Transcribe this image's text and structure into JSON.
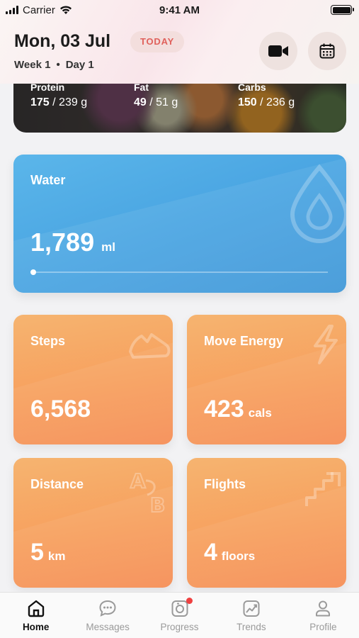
{
  "status_bar": {
    "carrier": "Carrier",
    "time": "9:41 AM"
  },
  "header": {
    "date": "Mon, 03 Jul",
    "badge": "TODAY",
    "week": "Week 1",
    "separator": "•",
    "day": "Day 1",
    "video_icon": "video-camera-icon",
    "calendar_icon": "calendar-icon"
  },
  "macros": [
    {
      "label": "Protein",
      "value": "175",
      "goal": "/ 239 g"
    },
    {
      "label": "Fat",
      "value": "49",
      "goal": "/ 51 g"
    },
    {
      "label": "Carbs",
      "value": "150",
      "goal": "/ 236 g"
    }
  ],
  "water": {
    "title": "Water",
    "value": "1,789",
    "unit": "ml",
    "icon": "water-drop-icon"
  },
  "metrics": {
    "steps": {
      "title": "Steps",
      "value": "6,568",
      "unit": "",
      "icon": "shoe-icon"
    },
    "move_energy": {
      "title": "Move Energy",
      "value": "423",
      "unit": "cals",
      "icon": "lightning-icon"
    },
    "distance": {
      "title": "Distance",
      "value": "5",
      "unit": "km",
      "icon": "a-to-b-icon"
    },
    "flights": {
      "title": "Flights",
      "value": "4",
      "unit": "floors",
      "icon": "stairs-icon"
    }
  },
  "tabs": [
    {
      "label": "Home",
      "icon": "home-icon",
      "active": true
    },
    {
      "label": "Messages",
      "icon": "chat-icon",
      "active": false
    },
    {
      "label": "Progress",
      "icon": "camera-icon",
      "active": false
    },
    {
      "label": "Trends",
      "icon": "trend-chart-icon",
      "active": false
    },
    {
      "label": "Profile",
      "icon": "person-icon",
      "active": false
    }
  ],
  "colors": {
    "water_card": "#4aa5e2",
    "metric_card": "#f7a05e",
    "today_badge_text": "#e0615c",
    "notification_dot": "#ef4040"
  }
}
